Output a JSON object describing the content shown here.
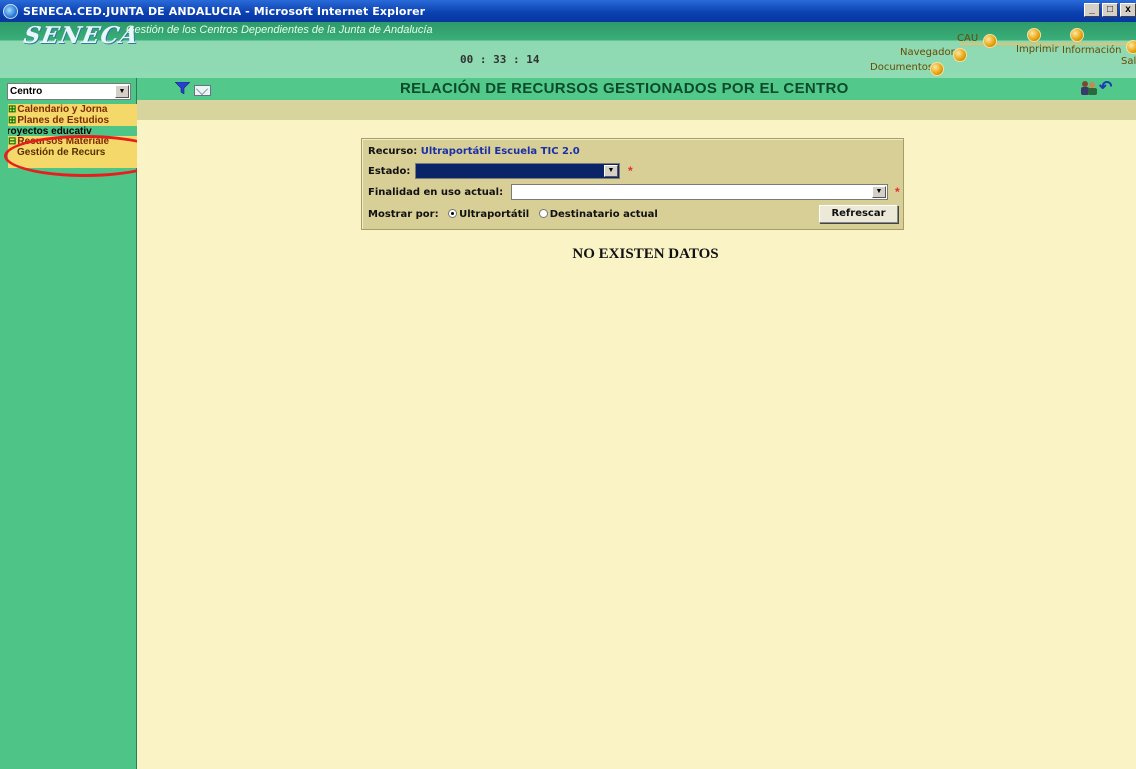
{
  "window": {
    "title": "SENECA.CED.JUNTA DE ANDALUCIA - Microsoft Internet Explorer",
    "buttons": [
      "_",
      "□",
      "x"
    ]
  },
  "header": {
    "logo": "SENECA",
    "subtitle": "Gestión de los Centros Dependientes de la Junta de Andalucía",
    "clock": "00 : 33 : 14",
    "links": {
      "cau": "CAU",
      "imprimir": "Imprimir",
      "informacion": "Información",
      "salir": "Sal",
      "navegador": "Navegador",
      "documentos": "Documentos"
    }
  },
  "sidebar": {
    "selector": "Centro",
    "menu": [
      {
        "label": "Calendario y Jorna",
        "expander": "⊞"
      },
      {
        "label": "Planes de Estudios",
        "expander": "⊞"
      },
      {
        "label": "Proyectos educativ",
        "expander": ""
      },
      {
        "label": "Recursos Materiale",
        "expander": "⊟"
      },
      {
        "label": "Gestión de Recurs",
        "expander": ""
      }
    ]
  },
  "toolbar": {
    "title": "RELACIÓN DE RECURSOS GESTIONADOS POR EL CENTRO",
    "icons": [
      "filter-icon",
      "mail-icon",
      "users-icon",
      "back-icon"
    ]
  },
  "form": {
    "recurso_label": "Recurso:",
    "recurso_value": "Ultraportátil Escuela TIC 2.0",
    "estado_label": "Estado:",
    "estado_value": "",
    "finalidad_label": "Finalidad en uso actual:",
    "finalidad_value": "",
    "required_mark": "*",
    "mostrar_label": "Mostrar por:",
    "option_ultraportatil": "Ultraportátil",
    "option_destinatario": "Destinatario actual",
    "selected_option": "Ultraportátil",
    "refresh_button": "Refrescar"
  },
  "results": {
    "message": "NO EXISTEN DATOS"
  },
  "colors": {
    "sidebar": "#4fc487",
    "content_bg": "#faf3c6",
    "filter_bg": "#d8cf96",
    "highlight": "#e81d1d"
  }
}
